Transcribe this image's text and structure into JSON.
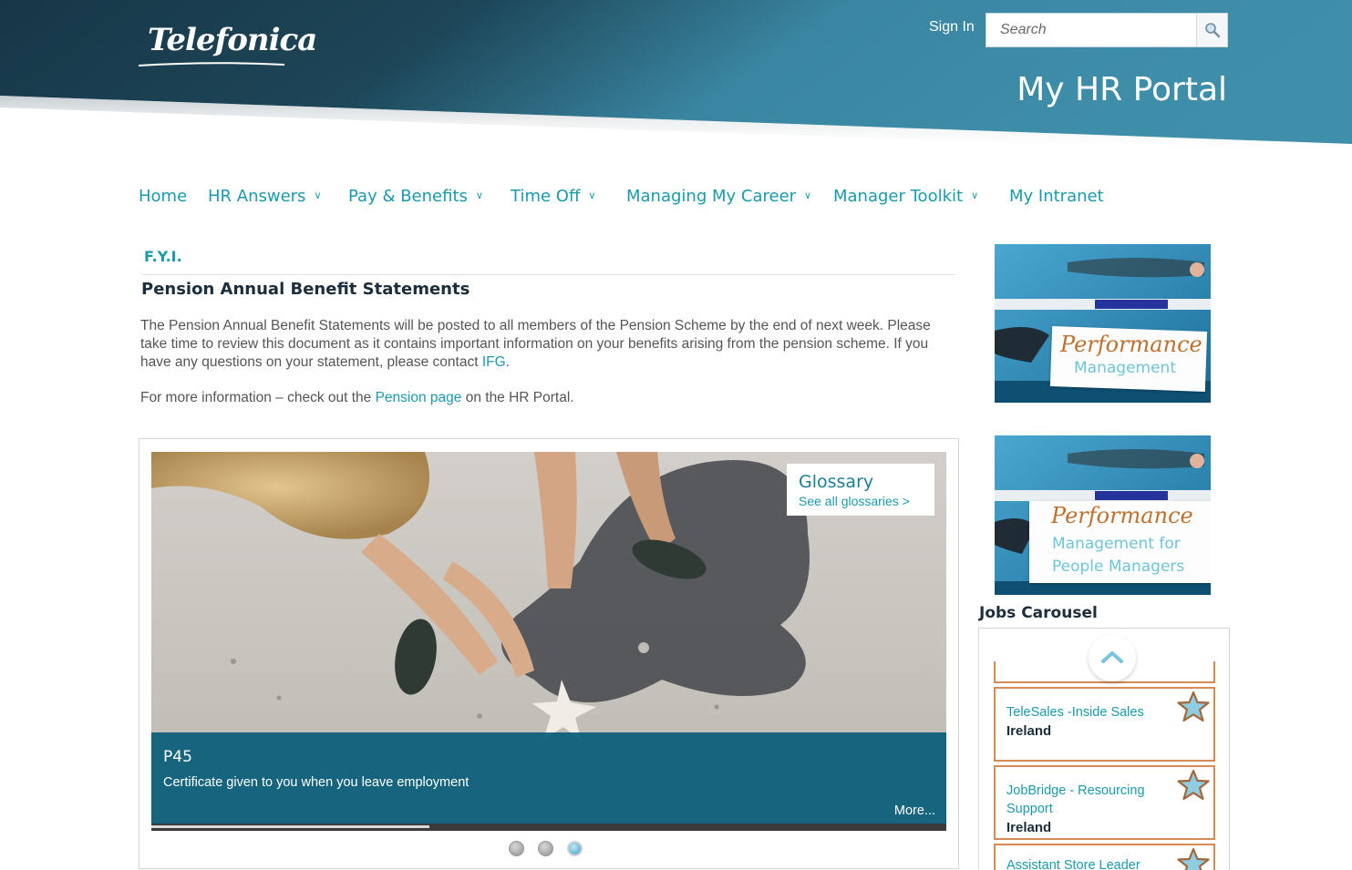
{
  "header": {
    "logo_text": "Telefonica",
    "sign_in_label": "Sign In",
    "search_placeholder": "Search",
    "portal_title": "My HR Portal",
    "colors": {
      "dark": "#173748",
      "light": "#3e8fab"
    }
  },
  "nav": {
    "items": [
      {
        "label": "Home",
        "has_dropdown": false
      },
      {
        "label": "HR Answers",
        "has_dropdown": true
      },
      {
        "label": "Pay & Benefits",
        "has_dropdown": true
      },
      {
        "label": "Time Off",
        "has_dropdown": true
      },
      {
        "label": "Managing My Career",
        "has_dropdown": true
      },
      {
        "label": "Manager Toolkit",
        "has_dropdown": true
      },
      {
        "label": "My Intranet",
        "has_dropdown": false
      }
    ],
    "chevron": "⌵"
  },
  "fyi": {
    "heading": "F.Y.I.",
    "article_title": "Pension Annual Benefit Statements",
    "body_text": "The Pension Annual Benefit Statements will be posted to all members of the Pension Scheme by the end of next week. Please take time to review this document as it contains important information on your benefits arising from the pension scheme. If you have any questions on your statement, please contact ",
    "body_link": "IFG",
    "body_end": ".",
    "more_prefix": "For more information – check out the ",
    "more_link": "Pension page",
    "more_suffix": " on the HR Portal."
  },
  "slideshow": {
    "glossary_title": "Glossary",
    "glossary_link": "See all glossaries >",
    "caption_title": "P45",
    "caption_text": "Certificate given to you when you leave employment",
    "more_label": "More...",
    "progress": 0.35,
    "slide_count": 3,
    "active_slide": 3
  },
  "banners": [
    {
      "script": "Performance",
      "sub_lines": [
        "Management"
      ]
    },
    {
      "script": "Performance",
      "sub_lines": [
        "Management for",
        "People Managers"
      ]
    }
  ],
  "jobs": {
    "heading": "Jobs Carousel",
    "items": [
      {
        "title": "TeleSales -Inside Sales",
        "location": "Ireland"
      },
      {
        "title": "JobBridge - Resourcing Support",
        "location": "Ireland"
      },
      {
        "title": "Assistant Store Leader",
        "location": ""
      }
    ]
  }
}
